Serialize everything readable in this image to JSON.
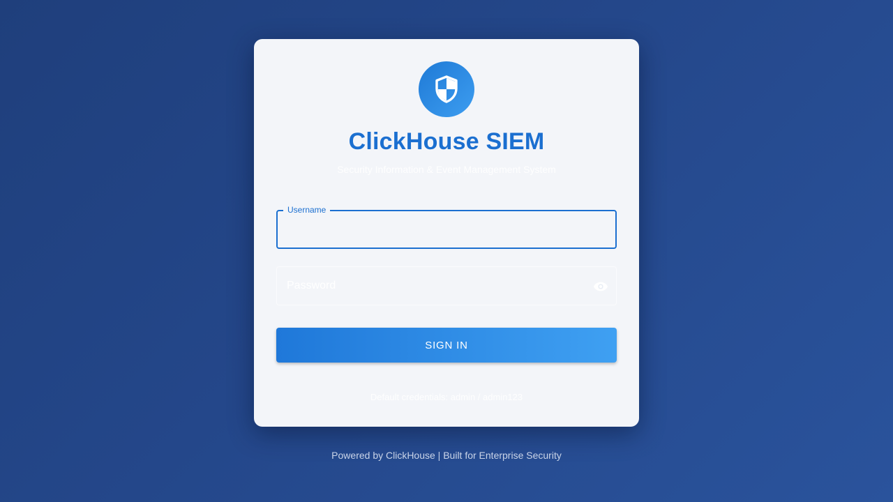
{
  "app": {
    "title": "ClickHouse SIEM",
    "subtitle": "Security Information & Event Management System",
    "logo_icon": "shield-icon"
  },
  "form": {
    "username": {
      "label": "Username",
      "value": ""
    },
    "password": {
      "placeholder": "Password",
      "value": "",
      "toggle_icon": "eye-icon"
    },
    "submit_label": "SIGN IN"
  },
  "hint": {
    "credentials": "Default credentials: admin / admin123"
  },
  "footer": {
    "text": "Powered by ClickHouse | Built for Enterprise Security"
  },
  "colors": {
    "accent": "#1b6fd0",
    "background": "#24478a",
    "card": "#f3f5f9"
  }
}
